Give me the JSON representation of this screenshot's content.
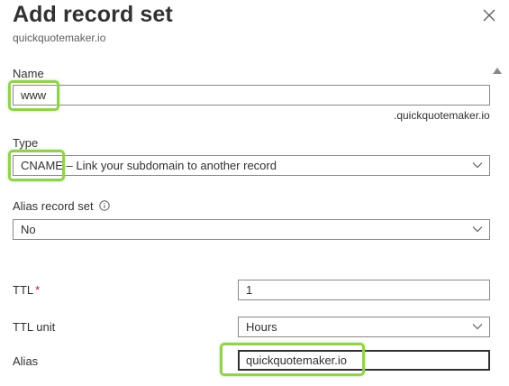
{
  "panel": {
    "title": "Add record set",
    "subtitle": "quickquotemaker.io"
  },
  "name_field": {
    "label": "Name",
    "value": "www",
    "suffix": ".quickquotemaker.io"
  },
  "type_field": {
    "label": "Type",
    "value": "CNAME – Link your subdomain to another record"
  },
  "alias_record_set": {
    "label": "Alias record set",
    "value": "No"
  },
  "ttl": {
    "label": "TTL",
    "required_mark": "*",
    "value": "1"
  },
  "ttl_unit": {
    "label": "TTL unit",
    "value": "Hours"
  },
  "alias": {
    "label": "Alias",
    "value": "quickquotemaker.io"
  },
  "colors": {
    "highlight": "#92d050",
    "border": "#8a8886",
    "required": "#a4262c"
  },
  "icons": [
    "close-icon",
    "info-icon",
    "chevron-down-icon",
    "scroll-up-icon"
  ]
}
